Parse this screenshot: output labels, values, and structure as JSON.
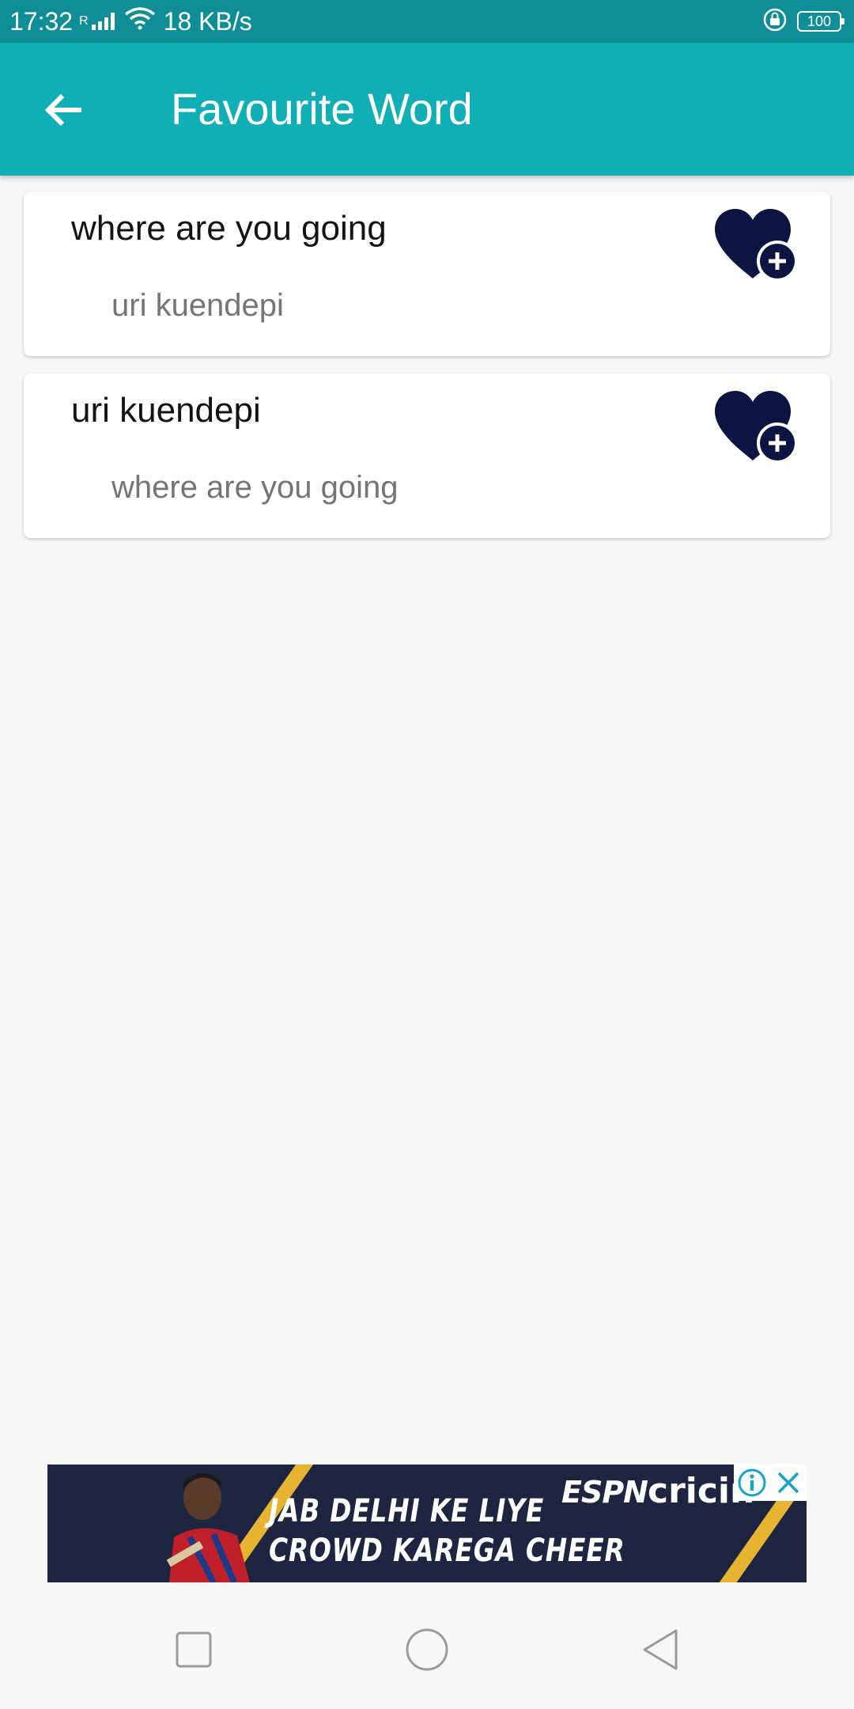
{
  "status_bar": {
    "time": "17:32",
    "network_label": "R",
    "speed": "18 KB/s",
    "battery": "100",
    "icons": [
      "signal-icon",
      "wifi-icon",
      "rotation-lock-icon",
      "battery-icon"
    ]
  },
  "app_bar": {
    "title": "Favourite Word",
    "back_icon": "arrow-back-icon",
    "background": "#10afb6"
  },
  "words": [
    {
      "word": "where are you going",
      "translation": "uri kuendepi",
      "icon": "heart-plus-icon"
    },
    {
      "word": "uri kuendepi",
      "translation": "where are you going",
      "icon": "heart-plus-icon"
    }
  ],
  "ad": {
    "line1": "JAB DELHI KE LIYE",
    "line2": "CROWD KAREGA CHEER",
    "brand_prefix": "ESPN",
    "brand_suffix": "cricin",
    "icons": [
      "ad-info-icon",
      "ad-close-icon"
    ]
  },
  "nav_bar": {
    "icons": [
      "recent-apps-icon",
      "home-icon",
      "back-icon"
    ]
  },
  "colors": {
    "status_bar": "#0f8e97",
    "app_bar": "#10afb6",
    "heart": "#0c1442",
    "ad_background": "#1d2540",
    "ad_stripe": "#e6b431"
  }
}
